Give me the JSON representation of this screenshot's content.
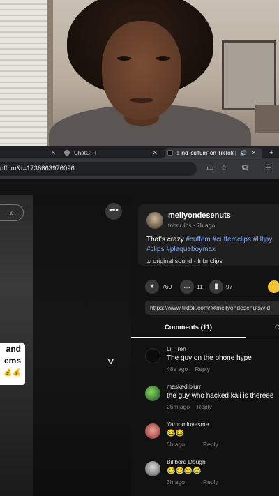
{
  "browser": {
    "tabs": [
      {
        "label": "",
        "close": "✕"
      },
      {
        "label": "ChatGPT",
        "close": "✕"
      },
      {
        "label": "Find 'cuffum' on TikTok |",
        "close": "✕"
      }
    ],
    "new_tab": "+",
    "address": "uffum&t=1736663976096"
  },
  "video": {
    "caption_lines": [
      "and",
      "ems",
      "💰💰"
    ],
    "more_icon": "more-horizontal-icon"
  },
  "post": {
    "username": "mellyondesenuts",
    "subline": "fnbr.clips · 7h ago",
    "desc_text": "That's crazy",
    "hashtags_line1": [
      "#cuffem",
      "#cuffemclips",
      "#liltjay"
    ],
    "hashtags_line2": [
      "#clips",
      "#plaqueboymax"
    ],
    "sound": "original sound - fnbr.clips",
    "counts": {
      "likes": "760",
      "comments": "11",
      "saves": "97"
    },
    "url": "https://www.tiktok.com/@mellyondesenuts/vid"
  },
  "tabs": {
    "comments": "Comments (11)",
    "creator": "C"
  },
  "comments": [
    {
      "name": "Lil Tren",
      "text": "The guy on the phone hype",
      "time": "48s ago",
      "reply": "Reply"
    },
    {
      "name": "masked.blurr",
      "text": "the guy who hacked kaii is thereee",
      "time": "26m ago",
      "reply": "Reply"
    },
    {
      "name": "Yamomlovesme",
      "text": "😂😂",
      "time": "5h ago",
      "reply": "Reply"
    },
    {
      "name": "Billbord Dough",
      "text": "😂😂😂😂",
      "time": "3h ago",
      "reply": "Reply"
    }
  ],
  "colors": {
    "hashtag": "#7aa9ff",
    "accent_gold": "#f1c232",
    "page_bg": "#121212"
  }
}
